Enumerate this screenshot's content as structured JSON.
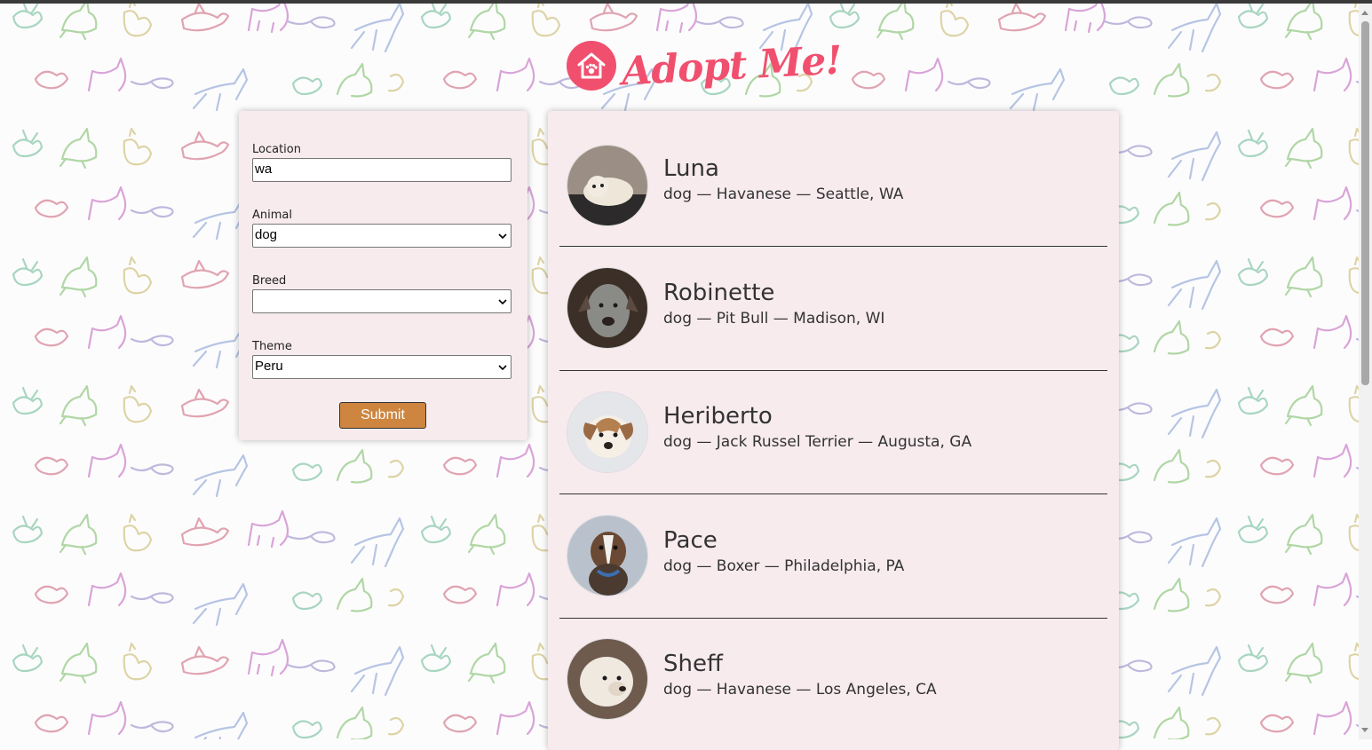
{
  "app": {
    "logo_text": "Adopt Me!",
    "brand_color": "#f0506e",
    "panel_color": "#f7ebee",
    "button_color": "#cd853f"
  },
  "search": {
    "location_label": "Location",
    "location_value": "wa",
    "animal_label": "Animal",
    "animal_value": "dog",
    "breed_label": "Breed",
    "breed_value": "",
    "theme_label": "Theme",
    "theme_value": "Peru",
    "submit_label": "Submit"
  },
  "pets": [
    {
      "name": "Luna",
      "info": "dog — Havanese — Seattle, WA",
      "photo_color": "#6b5a4c"
    },
    {
      "name": "Robinette",
      "info": "dog — Pit Bull — Madison, WI",
      "photo_color": "#4a3a30"
    },
    {
      "name": "Heriberto",
      "info": "dog — Jack Russel Terrier — Augusta, GA",
      "photo_color": "#b08060"
    },
    {
      "name": "Pace",
      "info": "dog — Boxer — Philadelphia, PA",
      "photo_color": "#5a4a3a"
    },
    {
      "name": "Sheff",
      "info": "dog — Havanese — Los Angeles, CA",
      "photo_color": "#7a6558"
    }
  ]
}
